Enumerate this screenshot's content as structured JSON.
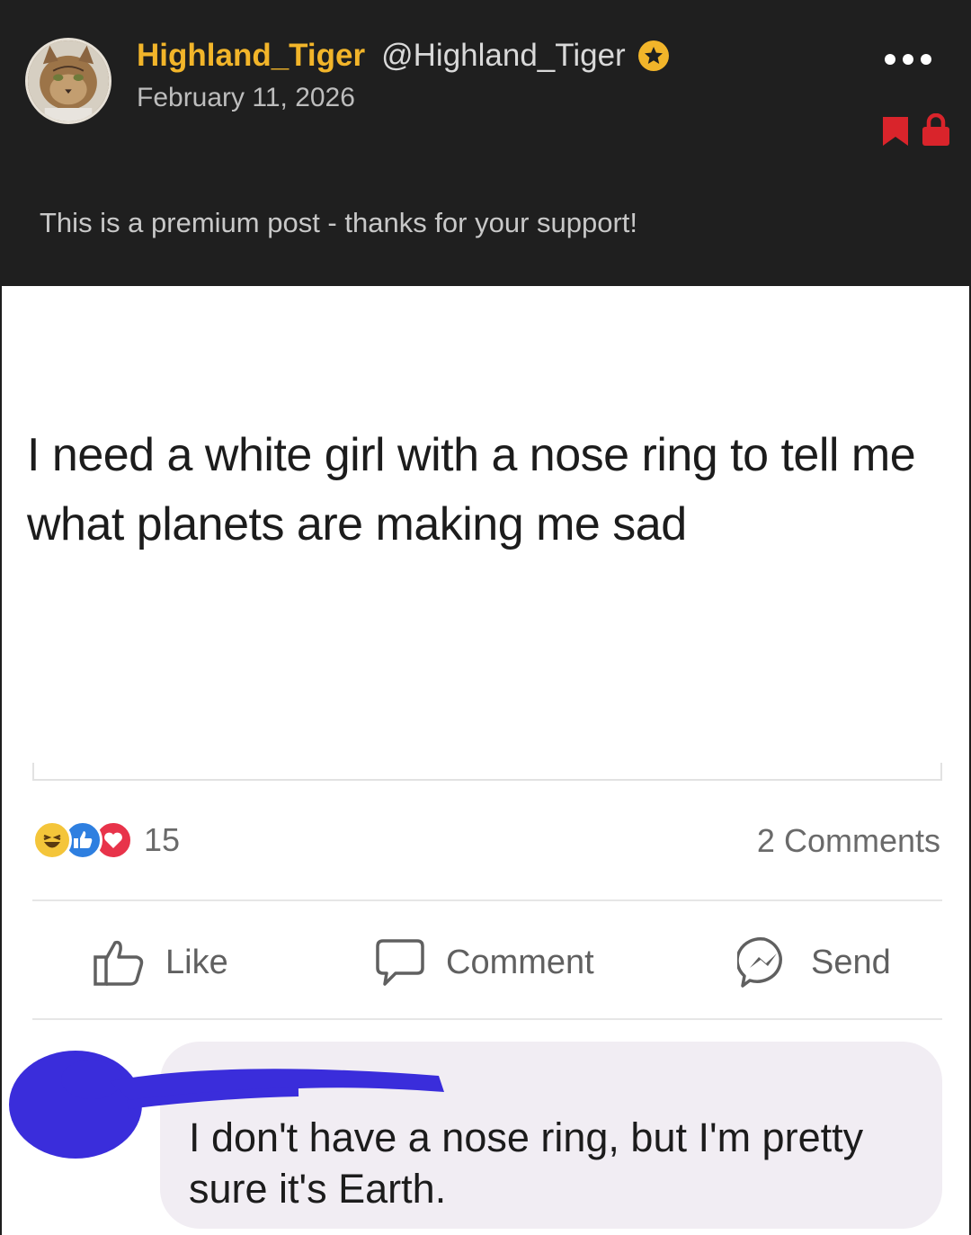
{
  "header": {
    "display_name": "Highland_Tiger",
    "handle": "@Highland_Tiger",
    "date": "February 11, 2026",
    "premium_note": "This is a premium post - thanks for your support!",
    "icons": {
      "badge": "star-icon",
      "menu": "more-options-icon",
      "bookmark": "bookmark-icon",
      "lock": "lock-icon"
    },
    "colors": {
      "name": "#f2b52a",
      "accent_red": "#d9242b",
      "background": "#1f1f1f"
    }
  },
  "post": {
    "text": "I need a white girl with a nose ring to tell me what planets are making me sad",
    "reaction_icons": [
      "haha-reaction-icon",
      "like-reaction-icon",
      "love-reaction-icon"
    ],
    "reaction_count": "15",
    "comments_count": "2 Comments",
    "actions": {
      "like": "Like",
      "comment": "Comment",
      "send": "Send"
    }
  },
  "comment": {
    "text": "I don't have a nose ring, but I'm pretty sure it's Earth."
  }
}
